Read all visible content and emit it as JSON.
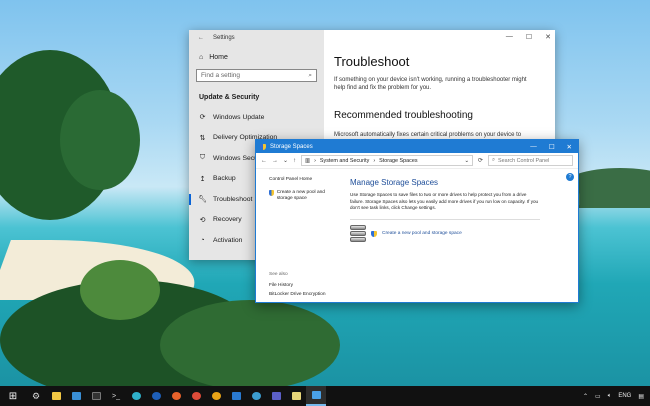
{
  "settings": {
    "title": "Settings",
    "home": "Home",
    "search_placeholder": "Find a setting",
    "section": "Update & Security",
    "nav": [
      {
        "label": "Windows Update",
        "icon": "refresh-icon"
      },
      {
        "label": "Delivery Optimization",
        "icon": "delivery-icon"
      },
      {
        "label": "Windows Security",
        "icon": "shield-icon"
      },
      {
        "label": "Backup",
        "icon": "backup-icon"
      },
      {
        "label": "Troubleshoot",
        "icon": "wrench-icon"
      },
      {
        "label": "Recovery",
        "icon": "recovery-icon"
      },
      {
        "label": "Activation",
        "icon": "activation-icon"
      }
    ],
    "selected": "Troubleshoot",
    "page_title": "Troubleshoot",
    "page_desc": "If something on your device isn't working, running a troubleshooter might help find and fix the problem for you.",
    "section2": "Recommended troubleshooting",
    "section2_text": "Microsoft automatically fixes certain critical problems on your device to"
  },
  "storage": {
    "title": "Storage Spaces",
    "breadcrumb": [
      "System and Security",
      "Storage Spaces"
    ],
    "search_placeholder": "Search Control Panel",
    "side_home": "Control Panel Home",
    "side_create": "Create a new pool and storage space",
    "see_also": "See also",
    "file_history": "File History",
    "bitlocker": "BitLocker Drive Encryption",
    "heading": "Manage Storage Spaces",
    "description": "Use Storage Spaces to save files to two or more drives to help protect you from a drive failure. Storage Spaces also lets you easily add more drives if you run low on capacity. If you don't see task links, click Change settings.",
    "create_link": "Create a new pool and storage space"
  },
  "taskbar": {
    "language": "ENG",
    "accent": "#1f7bd3"
  }
}
